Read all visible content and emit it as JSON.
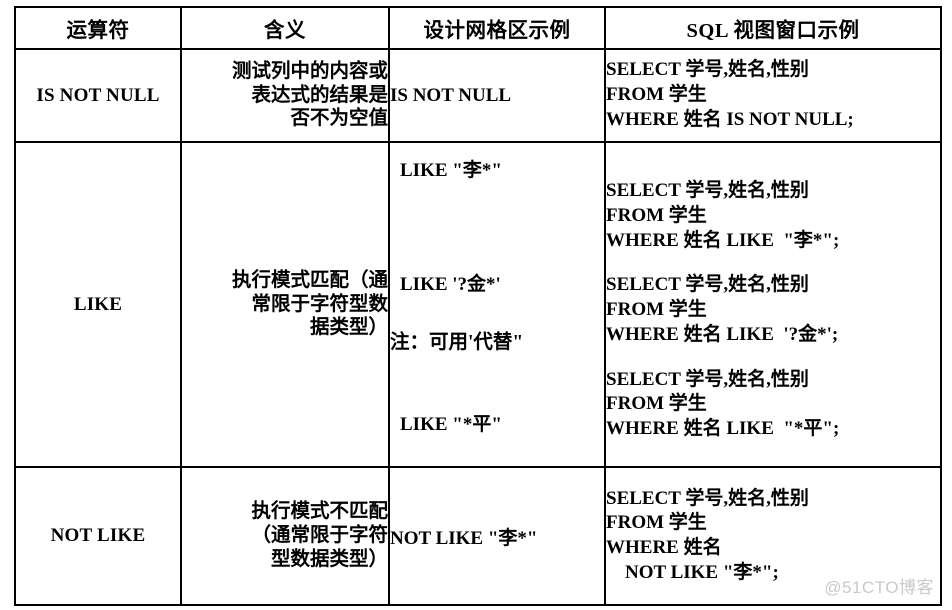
{
  "table": {
    "headers": [
      "运算符",
      "含义",
      "设计网格区示例",
      "SQL 视图窗口示例"
    ],
    "rows": [
      {
        "operator": "IS NOT NULL",
        "meaning": "测试列中的内容或表达式的结果是否不为空值",
        "meaning_lines": [
          "测试列中的内容或",
          "表达式的结果是",
          "否不为空值"
        ],
        "grid_examples": [
          "IS NOT NULL"
        ],
        "grid_note": "",
        "sql_blocks": [
          "SELECT 学号,姓名,性别\nFROM 学生\nWHERE 姓名 IS NOT NULL;"
        ]
      },
      {
        "operator": "LIKE",
        "meaning": "执行模式匹配（通常限于字符型数据类型）",
        "meaning_lines": [
          "执行模式匹配（通",
          "常限于字符型数",
          "据类型）"
        ],
        "grid_examples": [
          "LIKE \"李*\"",
          "LIKE '?金*'",
          "LIKE \"*平\""
        ],
        "grid_note": "注：可用'代替\"",
        "sql_blocks": [
          "SELECT 学号,姓名,性别\nFROM 学生\nWHERE 姓名 LIKE  \"李*\";",
          "SELECT 学号,姓名,性别\nFROM 学生\nWHERE 姓名 LIKE  '?金*';",
          "SELECT 学号,姓名,性别\nFROM 学生\nWHERE 姓名 LIKE  \"*平\";"
        ]
      },
      {
        "operator": "NOT LIKE",
        "meaning": "执行模式不匹配（通常限于字符型数据类型）",
        "meaning_lines": [
          "执行模式不匹配",
          "（通常限于字符",
          "型数据类型）"
        ],
        "grid_examples": [
          "NOT LIKE \"李*\""
        ],
        "grid_note": "",
        "sql_blocks": [
          "SELECT 学号,姓名,性别\nFROM 学生\nWHERE 姓名\n    NOT LIKE \"李*\";"
        ]
      }
    ]
  },
  "watermark": {
    "text": "@51CTO博客"
  }
}
